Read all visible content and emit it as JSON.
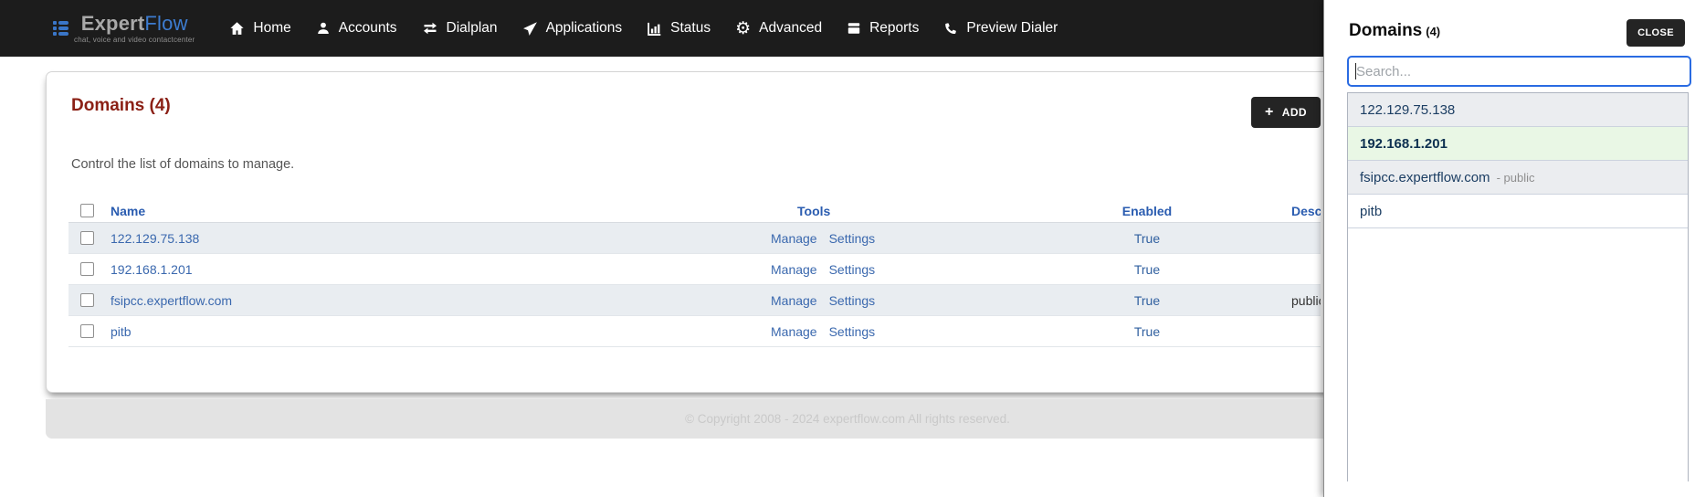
{
  "brand": {
    "primary": "Expert",
    "secondary": "Flow",
    "tagline": "chat, voice and video contactcenter"
  },
  "nav": {
    "items": [
      {
        "label": "Home",
        "icon": "home-icon"
      },
      {
        "label": "Accounts",
        "icon": "person-icon"
      },
      {
        "label": "Dialplan",
        "icon": "swap-arrows-icon"
      },
      {
        "label": "Applications",
        "icon": "paper-plane-icon"
      },
      {
        "label": "Status",
        "icon": "bar-chart-icon"
      },
      {
        "label": "Advanced",
        "icon": "gear-icon"
      },
      {
        "label": "Reports",
        "icon": "book-icon"
      },
      {
        "label": "Preview Dialer",
        "icon": "phone-icon"
      }
    ]
  },
  "page": {
    "title": "Domains (4)",
    "subtitle": "Control the list of domains to manage.",
    "add_plus": "+",
    "add_label": "ADD"
  },
  "table": {
    "headers": {
      "name": "Name",
      "tools": "Tools",
      "enabled": "Enabled",
      "description": "Description"
    },
    "rows": [
      {
        "name": "122.129.75.138",
        "manage": "Manage",
        "settings": "Settings",
        "enabled": "True",
        "description": ""
      },
      {
        "name": "192.168.1.201",
        "manage": "Manage",
        "settings": "Settings",
        "enabled": "True",
        "description": ""
      },
      {
        "name": "fsipcc.expertflow.com",
        "manage": "Manage",
        "settings": "Settings",
        "enabled": "True",
        "description": "public"
      },
      {
        "name": "pitb",
        "manage": "Manage",
        "settings": "Settings",
        "enabled": "True",
        "description": ""
      }
    ]
  },
  "footer": {
    "copyright": "© Copyright 2008 - 2024 expertflow.com All rights reserved."
  },
  "panel": {
    "title": "Domains",
    "count": "(4)",
    "close_label": "CLOSE",
    "search_placeholder": "Search...",
    "items": [
      {
        "label": "122.129.75.138",
        "note": ""
      },
      {
        "label": "192.168.1.201",
        "note": ""
      },
      {
        "label": "fsipcc.expertflow.com",
        "note": "- public"
      },
      {
        "label": "pitb",
        "note": ""
      }
    ]
  },
  "colors": {
    "nav_bg": "#1c1c1c",
    "brand_blue": "#3a76c8",
    "title_maroon": "#8b2015",
    "header_link_blue": "#2a5cb0",
    "link_blue": "#3a68ae",
    "row_shaded_bg": "#e9edf1",
    "button_dark": "#242424",
    "search_focus_blue": "#2a6be2",
    "selected_item_bg": "#e9f7e5",
    "panel_item_text": "#1c3e63",
    "footer_bg": "#e3e3e3"
  }
}
